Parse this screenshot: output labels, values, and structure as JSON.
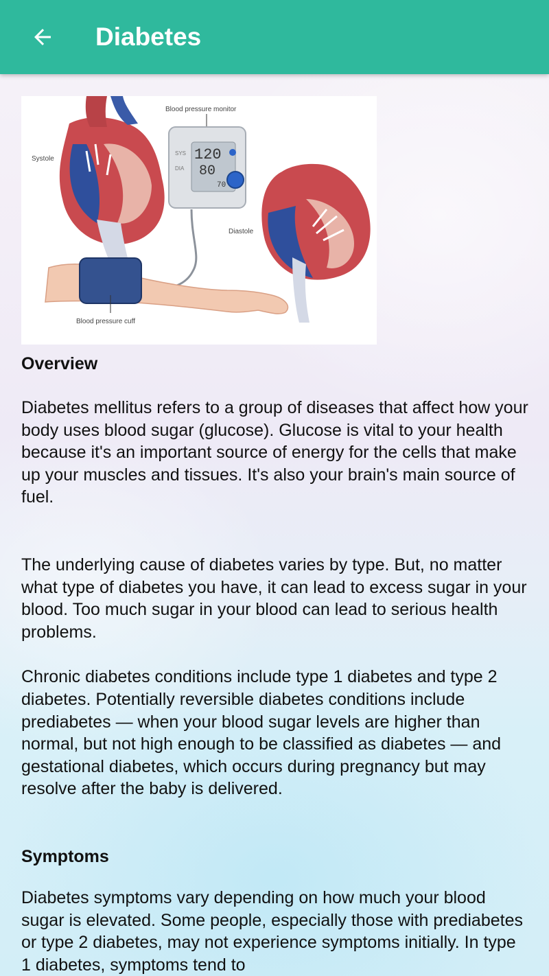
{
  "appbar": {
    "title": "Diabetes",
    "back_icon": "arrow-left-icon",
    "color": "#2fb99d"
  },
  "image": {
    "labels": {
      "monitor": "Blood pressure monitor",
      "systole": "Systole",
      "diastole": "Diastole",
      "cuff": "Blood pressure cuff",
      "sys_value": "120",
      "dia_value": "80",
      "pulse_value": "70",
      "sys_label": "SYS",
      "dia_label": "DIA"
    }
  },
  "sections": {
    "overview_heading": "Overview",
    "overview_p1": "Diabetes mellitus refers to a group of diseases that affect how your body uses blood sugar (glucose). Glucose is vital to your health because it's an important source of energy for the cells that make up your muscles and tissues. It's also your brain's main source of fuel.",
    "overview_p2": "The underlying cause of diabetes varies by type. But, no matter what type of diabetes you have, it can lead to excess sugar in your blood. Too much sugar in your blood can lead to serious health problems.",
    "overview_p3": "Chronic diabetes conditions include type 1 diabetes and type 2 diabetes. Potentially reversible diabetes conditions include prediabetes — when your blood sugar levels are higher than normal, but not high enough to be classified as diabetes — and gestational diabetes, which occurs during pregnancy but may resolve after the baby is delivered.",
    "symptoms_heading": "Symptoms",
    "symptoms_p1": "Diabetes symptoms vary depending on how much your blood sugar is elevated. Some people, especially those with prediabetes or type 2 diabetes, may not experience symptoms initially. In type 1 diabetes, symptoms tend to"
  }
}
